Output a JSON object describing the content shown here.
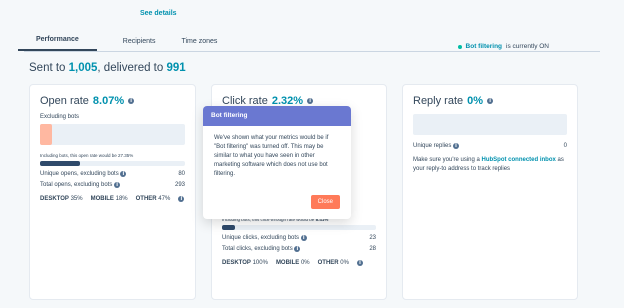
{
  "header": {
    "see_details": "See details",
    "tabs": [
      {
        "label": "Performance",
        "active": true
      },
      {
        "label": "Recipients",
        "active": false
      },
      {
        "label": "Time zones",
        "active": false
      }
    ],
    "bot_filter": {
      "label": "Bot filtering",
      "status": " is currently ON"
    }
  },
  "summary": {
    "prefix": "Sent to ",
    "sent": "1,005",
    "mid": ", delivered to ",
    "delivered": "991"
  },
  "cards": {
    "open": {
      "title": "Open rate",
      "rate": "8.07%",
      "excluding_bots": "Excluding bots",
      "incl_note": "Including bots, this open rate would be 27.35%",
      "unique_label": "Unique opens, excluding bots",
      "unique_value": "80",
      "total_label": "Total opens, excluding bots",
      "total_value": "293",
      "desktop_label": "DESKTOP",
      "desktop_val": "35%",
      "mobile_label": "MOBILE",
      "mobile_val": "18%",
      "other_label": "OTHER",
      "other_val": "47%",
      "bar_fill_pct": 0.0807,
      "incl_fill_pct": 0.2735
    },
    "click": {
      "title": "Click rate",
      "rate": "2.32%",
      "incl_note": "Including bots, this click-through rate would be ",
      "incl_rate": "8.41%",
      "unique_label": "Unique clicks, excluding bots",
      "unique_value": "23",
      "total_label": "Total clicks, excluding bots",
      "total_value": "28",
      "desktop_label": "DESKTOP",
      "desktop_val": "100%",
      "mobile_label": "MOBILE",
      "mobile_val": "0%",
      "other_label": "OTHER",
      "other_val": "0%",
      "incl_fill_pct": 0.0841
    },
    "reply": {
      "title": "Reply rate",
      "rate": "0%",
      "unique_label": "Unique replies",
      "unique_value": "0",
      "msg_prefix": "Make sure you're using a ",
      "msg_link": "HubSpot connected inbox",
      "msg_suffix": " as your reply-to address to track replies"
    }
  },
  "popover": {
    "title": "Bot filtering",
    "body": "We've shown what your metrics would be if \"Bot filtering\" was turned off. This may be similar to what you have seen in other marketing software which does not use bot filtering.",
    "close": "Close"
  },
  "colors": {
    "accent": "#0091ae",
    "popover": "#6a78d1",
    "cta": "#ff7a59",
    "status_on": "#00bda5"
  }
}
